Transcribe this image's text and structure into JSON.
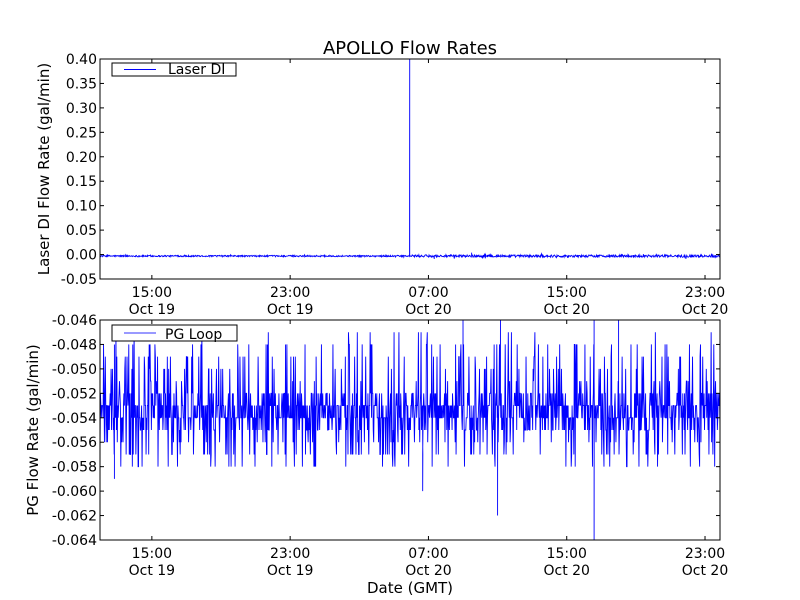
{
  "chart_data": [
    {
      "type": "line",
      "title": "APOLLO Flow Rates",
      "xlabel": "",
      "ylabel": "Laser DI Flow Rate (gal/min)",
      "xlim": [
        "2013-10-19T12:00",
        "2013-10-20T23:52"
      ],
      "ylim": [
        -0.05,
        0.4
      ],
      "yticks": [
        -0.05,
        0.0,
        0.05,
        0.1,
        0.15,
        0.2,
        0.25,
        0.3,
        0.35,
        0.4
      ],
      "ytick_labels": [
        "-0.05",
        "0.00",
        "0.05",
        "0.10",
        "0.15",
        "0.20",
        "0.25",
        "0.30",
        "0.35",
        "0.40"
      ],
      "xticks": [
        {
          "time": "2013-10-19T15:00",
          "label": [
            "15:00",
            "Oct 19"
          ]
        },
        {
          "time": "2013-10-19T23:00",
          "label": [
            "23:00",
            "Oct 19"
          ]
        },
        {
          "time": "2013-10-20T07:00",
          "label": [
            "07:00",
            "Oct 20"
          ]
        },
        {
          "time": "2013-10-20T15:00",
          "label": [
            "15:00",
            "Oct 20"
          ]
        },
        {
          "time": "2013-10-20T23:00",
          "label": [
            "23:00",
            "Oct 20"
          ]
        }
      ],
      "legend": {
        "entries": [
          "Laser DI"
        ],
        "placement": "top-left"
      },
      "grid": false,
      "series": [
        {
          "name": "Laser DI",
          "color": "#0000ff",
          "baseline": -0.003,
          "noise_amplitude": 0.003,
          "notable_points": [
            {
              "time": "2013-10-20T05:55",
              "value": 0.4
            },
            {
              "time": "2013-10-20T07:20",
              "value": -0.009
            },
            {
              "time": "2013-10-20T09:30",
              "value": 0.004
            }
          ]
        }
      ]
    },
    {
      "type": "line",
      "title": "",
      "xlabel": "Date (GMT)",
      "ylabel": "PG Flow Rate (gal/min)",
      "xlim": [
        "2013-10-19T12:00",
        "2013-10-20T23:52"
      ],
      "ylim": [
        -0.064,
        -0.046
      ],
      "yticks": [
        -0.064,
        -0.062,
        -0.06,
        -0.058,
        -0.056,
        -0.054,
        -0.052,
        -0.05,
        -0.048,
        -0.046
      ],
      "ytick_labels": [
        "-0.064",
        "-0.062",
        "-0.060",
        "-0.058",
        "-0.056",
        "-0.054",
        "-0.052",
        "-0.050",
        "-0.048",
        "-0.046"
      ],
      "xticks": [
        {
          "time": "2013-10-19T15:00",
          "label": [
            "15:00",
            "Oct 19"
          ]
        },
        {
          "time": "2013-10-19T23:00",
          "label": [
            "23:00",
            "Oct 19"
          ]
        },
        {
          "time": "2013-10-20T07:00",
          "label": [
            "07:00",
            "Oct 20"
          ]
        },
        {
          "time": "2013-10-20T15:00",
          "label": [
            "15:00",
            "Oct 20"
          ]
        },
        {
          "time": "2013-10-20T23:00",
          "label": [
            "23:00",
            "Oct 20"
          ]
        }
      ],
      "legend": {
        "entries": [
          "PG Loop"
        ],
        "placement": "top-left"
      },
      "grid": false,
      "series": [
        {
          "name": "PG Loop",
          "color": "#0000ff",
          "core_band": [
            -0.055,
            -0.052
          ],
          "resolution": 0.001,
          "notable_points": [
            {
              "time": "2013-10-19T12:50",
              "value": -0.048
            },
            {
              "time": "2013-10-19T12:50",
              "value": -0.059
            },
            {
              "time": "2013-10-20T06:40",
              "value": -0.06
            },
            {
              "time": "2013-10-20T09:00",
              "value": -0.046
            },
            {
              "time": "2013-10-20T11:00",
              "value": -0.062
            },
            {
              "time": "2013-10-20T11:10",
              "value": -0.046
            },
            {
              "time": "2013-10-20T16:35",
              "value": -0.064
            },
            {
              "time": "2013-10-20T16:35",
              "value": -0.046
            },
            {
              "time": "2013-10-20T18:00",
              "value": -0.046
            }
          ]
        }
      ]
    }
  ]
}
